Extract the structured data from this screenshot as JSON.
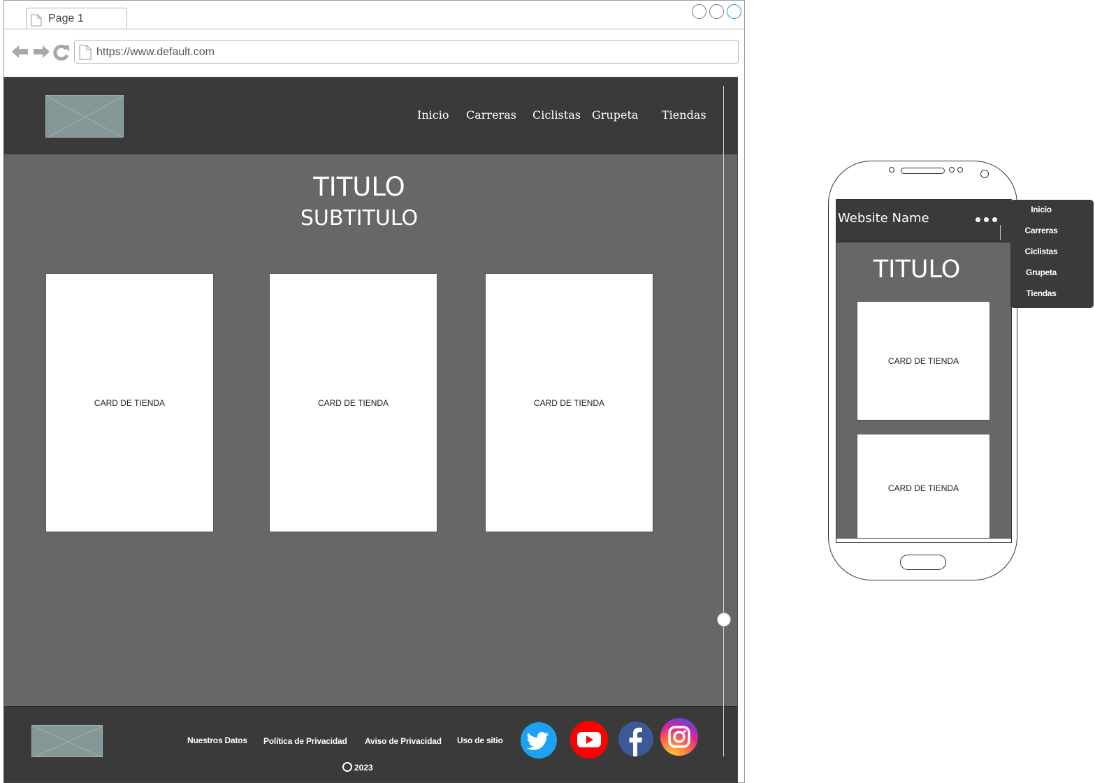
{
  "browser": {
    "tab_label": "Page 1",
    "url": "https://www.default.com"
  },
  "desktop": {
    "nav": [
      "Inicio",
      "Carreras",
      "Ciclistas",
      "Grupeta",
      "Tiendas"
    ],
    "title": "TITULO",
    "subtitle": "SUBTITULO",
    "cards": [
      "CARD DE TIENDA",
      "CARD DE TIENDA",
      "CARD DE TIENDA"
    ],
    "footer": {
      "links": [
        "Nuestros Datos",
        "Política de Privacidad",
        "Aviso de Privacidad",
        "Uso de sitio"
      ],
      "copyright": "2023",
      "social": [
        "twitter-icon",
        "youtube-icon",
        "facebook-icon",
        "instagram-icon"
      ]
    }
  },
  "mobile": {
    "site_name": "Website Name",
    "title": "TITULO",
    "cards": [
      "CARD DE TIENDA",
      "CARD DE TIENDA"
    ],
    "menu": [
      "Inicio",
      "Carreras",
      "Ciclistas",
      "Grupeta",
      "Tiendas"
    ]
  },
  "colors": {
    "header_bg": "#3a3a3a",
    "content_bg": "#676767",
    "placeholder_img": "#869797",
    "twitter": "#1da1f2",
    "youtube": "#ff0000",
    "facebook": "#3b5998"
  }
}
